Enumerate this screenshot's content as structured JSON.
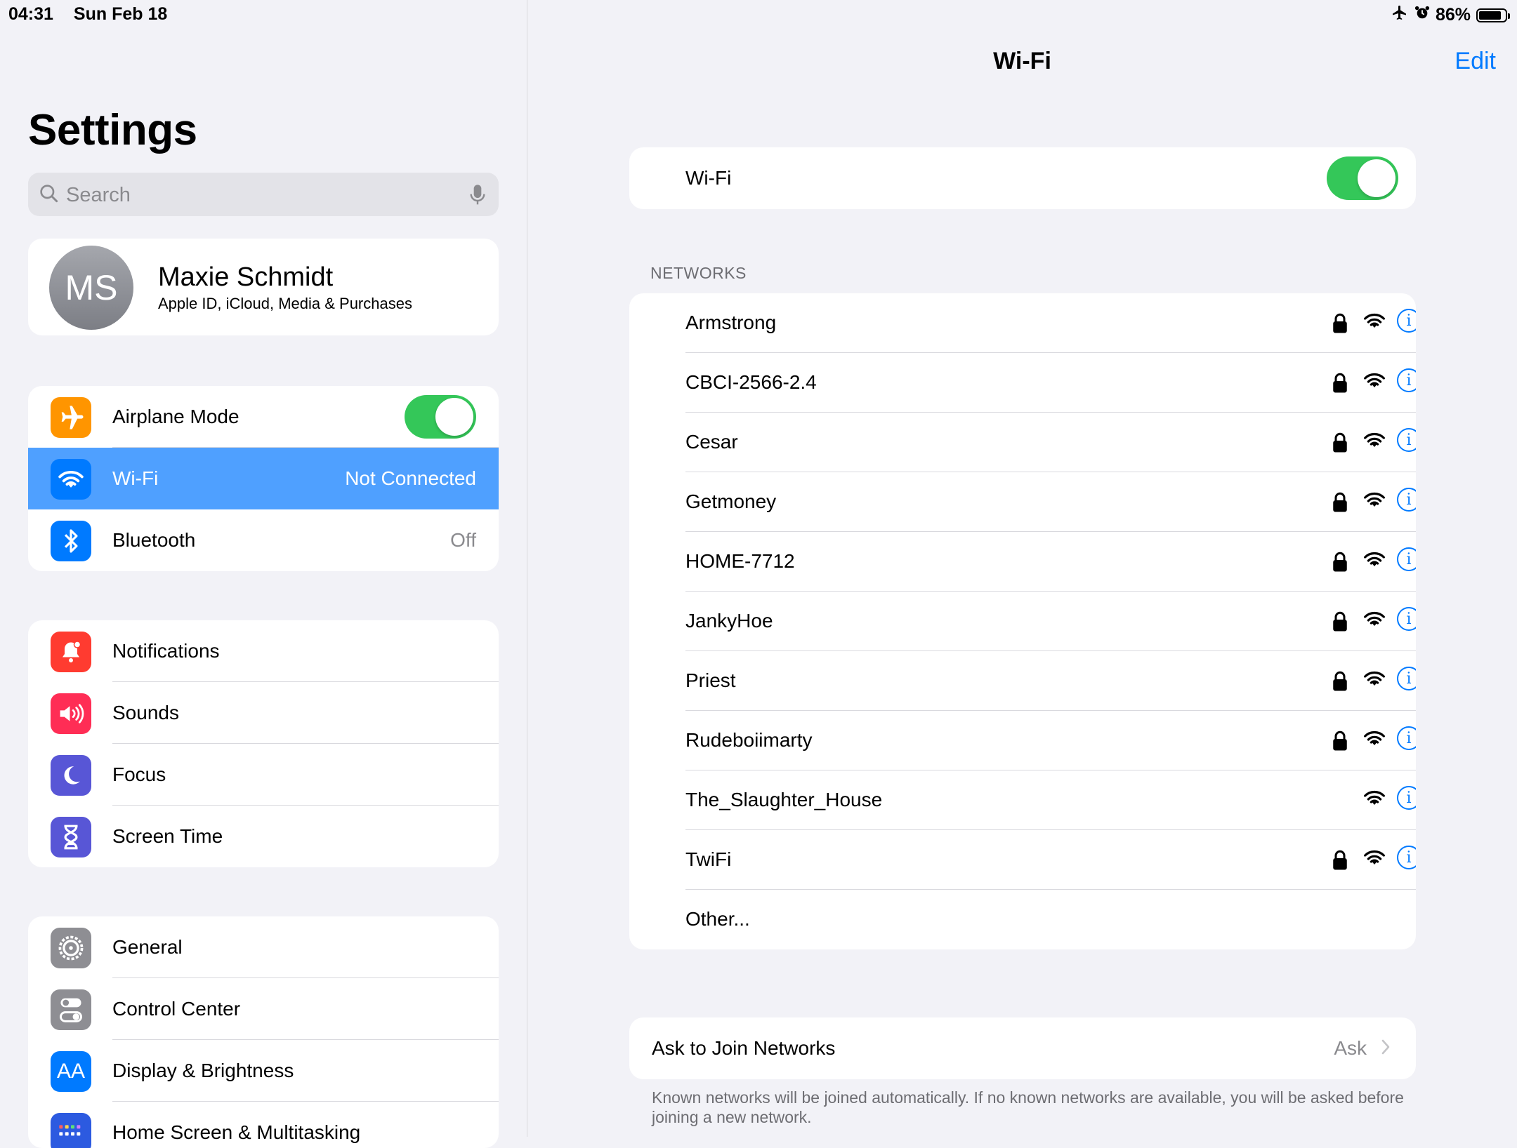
{
  "status_bar": {
    "time": "04:31",
    "date": "Sun Feb 18",
    "battery": "86%",
    "battery_level": 0.86
  },
  "sidebar": {
    "title": "Settings",
    "search_placeholder": "Search",
    "profile": {
      "initials": "MS",
      "name": "Maxie Schmidt",
      "subtitle": "Apple ID, iCloud, Media & Purchases"
    },
    "group1": [
      {
        "label": "Airplane Mode",
        "icon": "airplane-icon",
        "color": "#ff9500",
        "toggle": true
      },
      {
        "label": "Wi-Fi",
        "value": "Not Connected",
        "icon": "wifi-icon",
        "color": "#007aff",
        "selected": true
      },
      {
        "label": "Bluetooth",
        "value": "Off",
        "icon": "bluetooth-icon",
        "color": "#007aff"
      }
    ],
    "group2": [
      {
        "label": "Notifications",
        "icon": "bell-icon",
        "color": "#ff3b30"
      },
      {
        "label": "Sounds",
        "icon": "speaker-icon",
        "color": "#ff2d55"
      },
      {
        "label": "Focus",
        "icon": "moon-icon",
        "color": "#5856d6"
      },
      {
        "label": "Screen Time",
        "icon": "hourglass-icon",
        "color": "#5856d6"
      }
    ],
    "group3": [
      {
        "label": "General",
        "icon": "gear-icon",
        "color": "#8e8e93"
      },
      {
        "label": "Control Center",
        "icon": "switches-icon",
        "color": "#8e8e93"
      },
      {
        "label": "Display & Brightness",
        "icon": "text-size-icon",
        "color": "#007aff",
        "icon_text": "AA"
      },
      {
        "label": "Home Screen & Multitasking",
        "icon": "home-grid-icon",
        "color": "#2c5ae0"
      }
    ]
  },
  "main": {
    "title": "Wi-Fi",
    "edit_label": "Edit",
    "wifi_label": "Wi-Fi",
    "wifi_on": true,
    "networks_header": "NETWORKS",
    "networks": [
      {
        "name": "Armstrong",
        "locked": true
      },
      {
        "name": "CBCI-2566-2.4",
        "locked": true
      },
      {
        "name": "Cesar",
        "locked": true
      },
      {
        "name": "Getmoney",
        "locked": true
      },
      {
        "name": "HOME-7712",
        "locked": true
      },
      {
        "name": "JankyHoe",
        "locked": true
      },
      {
        "name": "Priest",
        "locked": true
      },
      {
        "name": "Rudeboiimarty",
        "locked": true
      },
      {
        "name": "The_Slaughter_House",
        "locked": false
      },
      {
        "name": "TwiFi",
        "locked": true
      }
    ],
    "other_label": "Other...",
    "ask_to_join": {
      "label": "Ask to Join Networks",
      "value": "Ask"
    },
    "footnote": "Known networks will be joined automatically. If no known networks are available, you will be asked before joining a new network."
  },
  "colors": {
    "accent": "#007aff",
    "toggle_on": "#34c759",
    "selection": "#4fa0ff"
  }
}
